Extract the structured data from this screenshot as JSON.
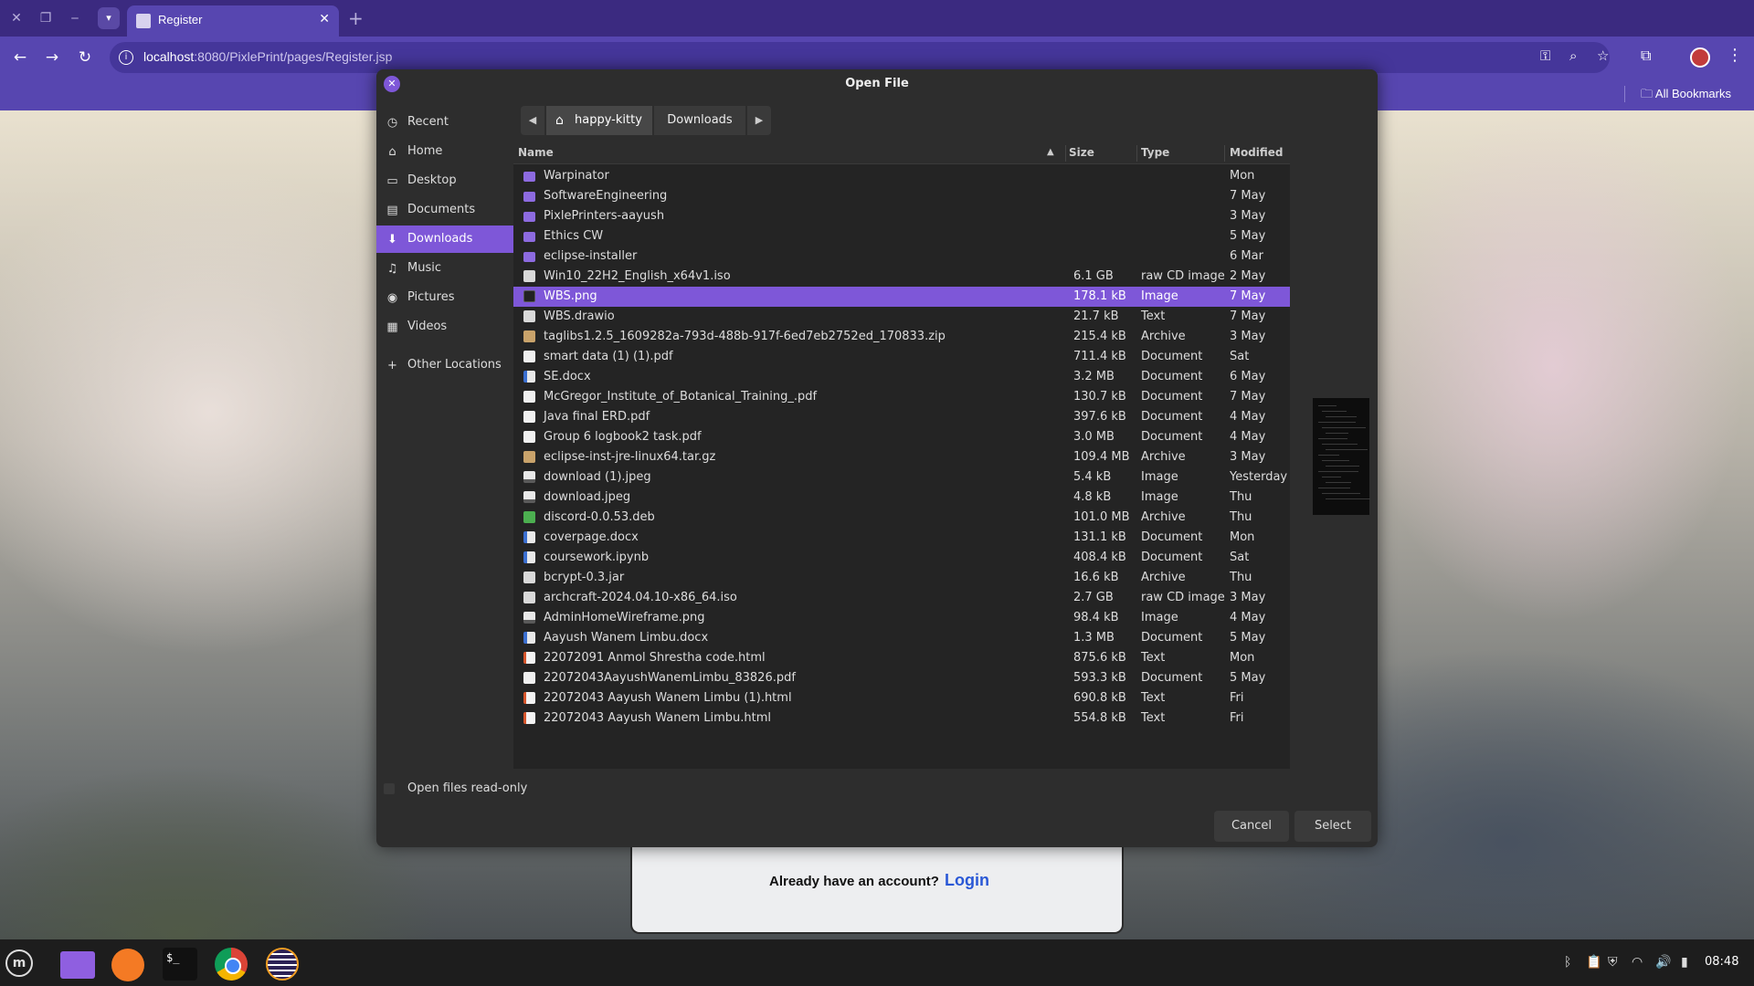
{
  "browser": {
    "tab_title": "Register",
    "url_host": "localhost",
    "url_path": ":8080/PixlePrint/pages/Register.jsp",
    "bookmarks_label": "All Bookmarks",
    "icons": [
      "close-window-icon",
      "restore-window-icon",
      "minimize-window-icon",
      "tab-search-icon",
      "back-icon",
      "forward-icon",
      "reload-icon",
      "info-icon",
      "password-key-icon",
      "zoom-icon",
      "star-icon",
      "extensions-icon",
      "profile-icon",
      "menu-icon",
      "folder-icon"
    ]
  },
  "page": {
    "login_prompt": "Already have an account?",
    "login_link": "Login"
  },
  "dialog": {
    "title": "Open File",
    "places": [
      {
        "label": "Recent",
        "icon": "clock-icon"
      },
      {
        "label": "Home",
        "icon": "home-icon"
      },
      {
        "label": "Desktop",
        "icon": "desktop-icon"
      },
      {
        "label": "Documents",
        "icon": "document-icon"
      },
      {
        "label": "Downloads",
        "icon": "download-icon",
        "active": true
      },
      {
        "label": "Music",
        "icon": "music-icon"
      },
      {
        "label": "Pictures",
        "icon": "camera-icon"
      },
      {
        "label": "Videos",
        "icon": "film-icon"
      },
      {
        "label": "Other Locations",
        "icon": "plus-icon"
      }
    ],
    "path": {
      "home": "happy-kitty",
      "current": "Downloads"
    },
    "columns": {
      "name": "Name",
      "size": "Size",
      "type": "Type",
      "modified": "Modified"
    },
    "files": [
      {
        "name": "Warpinator",
        "size": "",
        "type": "",
        "modified": "Mon",
        "kind": "folder"
      },
      {
        "name": "SoftwareEngineering",
        "size": "",
        "type": "",
        "modified": "7 May",
        "kind": "folder"
      },
      {
        "name": "PixlePrinters-aayush",
        "size": "",
        "type": "",
        "modified": "3 May",
        "kind": "folder"
      },
      {
        "name": "Ethics CW",
        "size": "",
        "type": "",
        "modified": "5 May",
        "kind": "folder"
      },
      {
        "name": "eclipse-installer",
        "size": "",
        "type": "",
        "modified": "6 Mar",
        "kind": "folder"
      },
      {
        "name": "Win10_22H2_English_x64v1.iso",
        "size": "6.1 GB",
        "type": "raw CD image",
        "modified": "2 May",
        "kind": "file"
      },
      {
        "name": "WBS.png",
        "size": "178.1 kB",
        "type": "Image",
        "modified": "7 May",
        "kind": "dark",
        "selected": true
      },
      {
        "name": "WBS.drawio",
        "size": "21.7 kB",
        "type": "Text",
        "modified": "7 May",
        "kind": "file"
      },
      {
        "name": "taglibs1.2.5_1609282a-793d-488b-917f-6ed7eb2752ed_170833.zip",
        "size": "215.4 kB",
        "type": "Archive",
        "modified": "3 May",
        "kind": "archive"
      },
      {
        "name": "smart data (1) (1).pdf",
        "size": "711.4 kB",
        "type": "Document",
        "modified": "Sat",
        "kind": "pdf"
      },
      {
        "name": "SE.docx",
        "size": "3.2 MB",
        "type": "Document",
        "modified": "6 May",
        "kind": "doc"
      },
      {
        "name": "McGregor_Institute_of_Botanical_Training_.pdf",
        "size": "130.7 kB",
        "type": "Document",
        "modified": "7 May",
        "kind": "pdf"
      },
      {
        "name": "Java final ERD.pdf",
        "size": "397.6 kB",
        "type": "Document",
        "modified": "4 May",
        "kind": "pdf"
      },
      {
        "name": "Group 6 logbook2 task.pdf",
        "size": "3.0 MB",
        "type": "Document",
        "modified": "4 May",
        "kind": "pdf"
      },
      {
        "name": "eclipse-inst-jre-linux64.tar.gz",
        "size": "109.4 MB",
        "type": "Archive",
        "modified": "3 May",
        "kind": "archive"
      },
      {
        "name": "download (1).jpeg",
        "size": "5.4 kB",
        "type": "Image",
        "modified": "Yesterday",
        "kind": "img"
      },
      {
        "name": "download.jpeg",
        "size": "4.8 kB",
        "type": "Image",
        "modified": "Thu",
        "kind": "img"
      },
      {
        "name": "discord-0.0.53.deb",
        "size": "101.0 MB",
        "type": "Archive",
        "modified": "Thu",
        "kind": "deb"
      },
      {
        "name": "coverpage.docx",
        "size": "131.1 kB",
        "type": "Document",
        "modified": "Mon",
        "kind": "doc"
      },
      {
        "name": "coursework.ipynb",
        "size": "408.4 kB",
        "type": "Document",
        "modified": "Sat",
        "kind": "doc"
      },
      {
        "name": "bcrypt-0.3.jar",
        "size": "16.6 kB",
        "type": "Archive",
        "modified": "Thu",
        "kind": "file"
      },
      {
        "name": "archcraft-2024.04.10-x86_64.iso",
        "size": "2.7 GB",
        "type": "raw CD image",
        "modified": "3 May",
        "kind": "file"
      },
      {
        "name": "AdminHomeWireframe.png",
        "size": "98.4 kB",
        "type": "Image",
        "modified": "4 May",
        "kind": "img"
      },
      {
        "name": "Aayush Wanem Limbu.docx",
        "size": "1.3 MB",
        "type": "Document",
        "modified": "5 May",
        "kind": "doc"
      },
      {
        "name": "22072091 Anmol Shrestha code.html",
        "size": "875.6 kB",
        "type": "Text",
        "modified": "Mon",
        "kind": "text"
      },
      {
        "name": "22072043AayushWanemLimbu_83826.pdf",
        "size": "593.3 kB",
        "type": "Document",
        "modified": "5 May",
        "kind": "pdf"
      },
      {
        "name": "22072043 Aayush Wanem Limbu (1).html",
        "size": "690.8 kB",
        "type": "Text",
        "modified": "Fri",
        "kind": "text"
      },
      {
        "name": "22072043 Aayush Wanem Limbu.html",
        "size": "554.8 kB",
        "type": "Text",
        "modified": "Fri",
        "kind": "text"
      }
    ],
    "readonly_label": "Open files read-only",
    "cancel_label": "Cancel",
    "select_label": "Select"
  },
  "taskbar": {
    "clock": "08:48",
    "apps": [
      "files-icon",
      "firefox-icon",
      "terminal-icon",
      "chrome-icon",
      "eclipse-icon"
    ],
    "tray": [
      "bluetooth-icon",
      "clipboard-icon",
      "shield-icon",
      "wifi-icon",
      "volume-icon",
      "battery-icon"
    ]
  },
  "colors": {
    "accent": "#7e57d8",
    "browser_frame": "#5746b0",
    "tab_strip": "#3b2a80"
  }
}
